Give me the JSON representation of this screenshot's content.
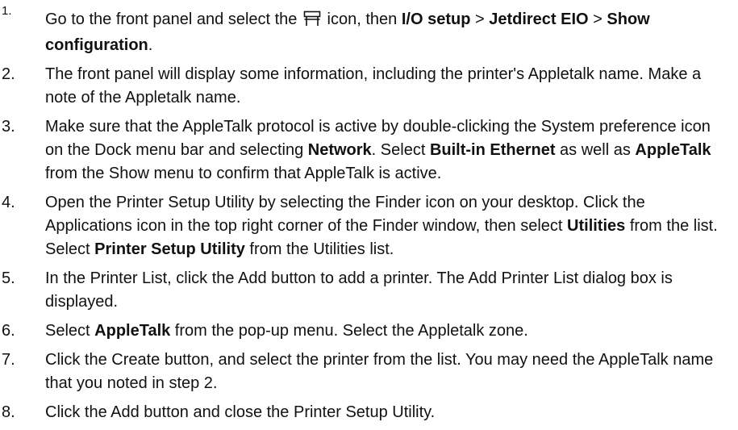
{
  "steps": [
    {
      "number": "1.",
      "parts": [
        {
          "text": "Go to the front panel and select the ",
          "bold": false
        },
        {
          "icon": "setup-icon"
        },
        {
          "text": " icon, then ",
          "bold": false
        },
        {
          "text": "I/O setup",
          "bold": true
        },
        {
          "text": " > ",
          "bold": false
        },
        {
          "text": "Jetdirect EIO",
          "bold": true
        },
        {
          "text": " > ",
          "bold": false
        },
        {
          "text": "Show configuration",
          "bold": true
        },
        {
          "text": ".",
          "bold": false
        }
      ]
    },
    {
      "number": "2.",
      "parts": [
        {
          "text": "The front panel will display some information, including the printer's Appletalk name. Make a note of the Appletalk name.",
          "bold": false
        }
      ]
    },
    {
      "number": "3.",
      "parts": [
        {
          "text": "Make sure that the AppleTalk protocol is active by double-clicking the System preference icon on the Dock menu bar and selecting ",
          "bold": false
        },
        {
          "text": "Network",
          "bold": true
        },
        {
          "text": ". Select ",
          "bold": false
        },
        {
          "text": "Built-in Ethernet",
          "bold": true
        },
        {
          "text": " as well as ",
          "bold": false
        },
        {
          "text": "AppleTalk",
          "bold": true
        },
        {
          "text": " from the Show menu to confirm that AppleTalk is active.",
          "bold": false
        }
      ]
    },
    {
      "number": "4.",
      "parts": [
        {
          "text": "Open the Printer Setup Utility by selecting the Finder icon on your desktop. Click the Applications icon in the top right corner of the Finder window, then select ",
          "bold": false
        },
        {
          "text": "Utilities",
          "bold": true
        },
        {
          "text": " from the list. Select ",
          "bold": false
        },
        {
          "text": "Printer Setup Utility",
          "bold": true
        },
        {
          "text": " from the Utilities list.",
          "bold": false
        }
      ]
    },
    {
      "number": "5.",
      "parts": [
        {
          "text": "In the Printer List, click the Add button to add a printer. The Add Printer List dialog box is displayed.",
          "bold": false
        }
      ]
    },
    {
      "number": "6.",
      "parts": [
        {
          "text": "Select ",
          "bold": false
        },
        {
          "text": "AppleTalk",
          "bold": true
        },
        {
          "text": " from the pop-up menu. Select the Appletalk zone.",
          "bold": false
        }
      ]
    },
    {
      "number": "7.",
      "parts": [
        {
          "text": "Click the Create button, and select the printer from the list. You may need the AppleTalk name that you noted in step 2.",
          "bold": false
        }
      ]
    },
    {
      "number": "8.",
      "parts": [
        {
          "text": "Click the Add button and close the Printer Setup Utility.",
          "bold": false
        }
      ]
    }
  ]
}
